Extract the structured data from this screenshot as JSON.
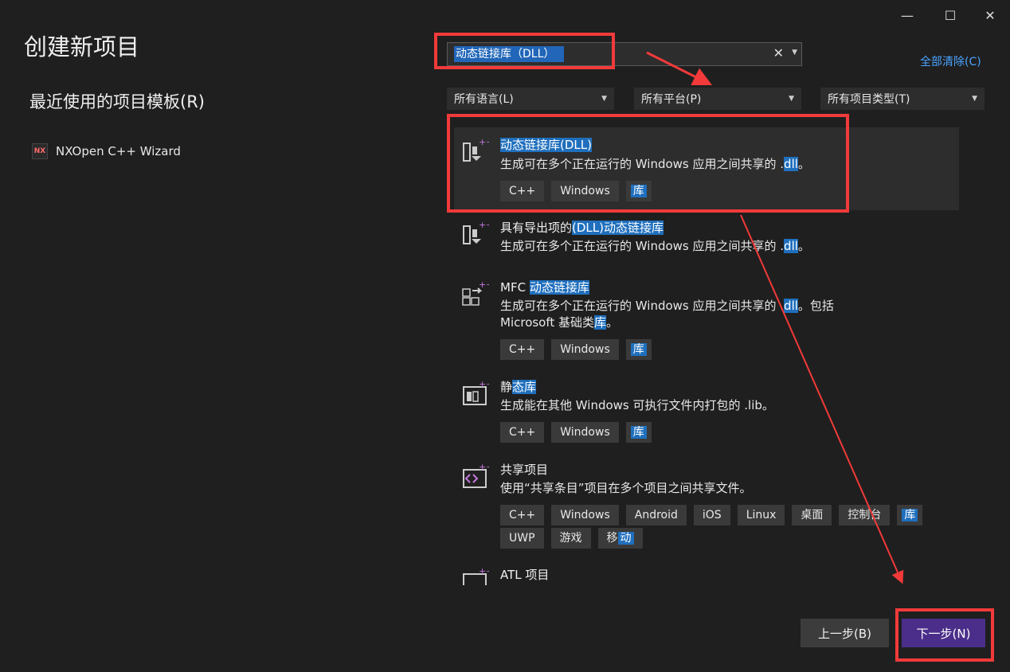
{
  "window": {
    "minimize_icon": "minimize-icon",
    "maximize_icon": "maximize-icon",
    "close_icon": "close-icon",
    "min_glyph": "—",
    "max_glyph": "☐",
    "close_glyph": "✕"
  },
  "page_title": "创建新项目",
  "recent": {
    "title": "最近使用的项目模板(R)",
    "items": [
      {
        "icon": "nx-icon",
        "icon_text": "NX",
        "label": "NXOpen C++ Wizard"
      }
    ]
  },
  "search": {
    "value": "动态链接库（DLL）",
    "clear_glyph": "✕"
  },
  "clear_all_label": "全部清除(C)",
  "filters": {
    "language": "所有语言(L)",
    "platform": "所有平台(P)",
    "project_type": "所有项目类型(T)"
  },
  "templates": [
    {
      "name": "动态链接库(DLL)",
      "desc_pre": "生成可在多个正在运行的 Windows 应用之间共享的 .",
      "desc_hl": "dll",
      "desc_post": "。",
      "tags": [
        "C++",
        "Windows"
      ],
      "tag_hl": "库"
    },
    {
      "name_pre": "具有导出项的",
      "name_hl": "(DLL)动态链接库",
      "desc_pre": "生成可在多个正在运行的 Windows 应用之间共享的 .",
      "desc_hl": "dll",
      "desc_post": "。"
    },
    {
      "name_pre": "MFC ",
      "name_hl": "动态链接库",
      "desc_pre": "生成可在多个正在运行的 Windows 应用之间共享的 .",
      "desc_hl": "dll",
      "desc_post": "。包括",
      "desc2_pre": "Microsoft 基础类",
      "desc2_hl": "库",
      "desc2_post": "。",
      "tags": [
        "C++",
        "Windows"
      ],
      "tag_hl": "库"
    },
    {
      "name_pre": "静",
      "name_hl": "态库",
      "desc": "生成能在其他 Windows 可执行文件内打包的 .lib。",
      "tags": [
        "C++",
        "Windows"
      ],
      "tag_hl": "库"
    },
    {
      "name": "共享项目",
      "desc": "使用“共享条目”项目在多个项目之间共享文件。",
      "tags": [
        "C++",
        "Windows",
        "Android",
        "iOS",
        "Linux",
        "桌面",
        "控制台"
      ],
      "tag_hl": "库",
      "tags2": [
        "UWP",
        "游戏"
      ],
      "tag_last_pre": "移",
      "tag_last_hl": "动"
    },
    {
      "name": "ATL 项目"
    }
  ],
  "buttons": {
    "prev": "上一步(B)",
    "next": "下一步(N)"
  },
  "annotation_color": "#f23a3a",
  "accent_color": "#4b2e8a",
  "highlight_color": "#1f6fbd"
}
